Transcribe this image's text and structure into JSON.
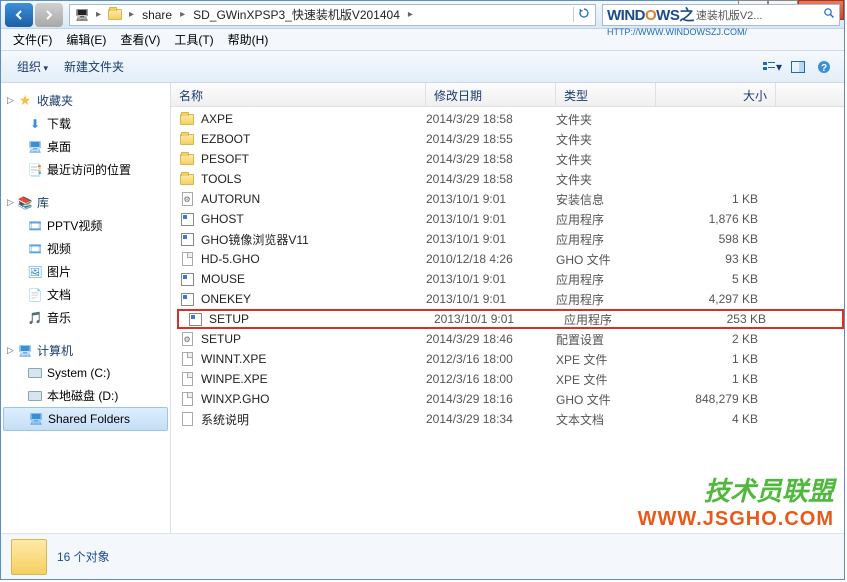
{
  "titlebar": {
    "breadcrumb": {
      "segments": [
        "share",
        "SD_GWinXPSP3_快速装机版V201404"
      ],
      "refresh": "↻"
    },
    "search": {
      "logo_prefix": "WIND",
      "logo_o": "O",
      "logo_suffix": "WS之",
      "placeholder_suffix": "速装机版V2...",
      "url": "HTTP://WWW.WINDOWSZJ.COM/"
    }
  },
  "menubar": {
    "items": [
      "文件(F)",
      "编辑(E)",
      "查看(V)",
      "工具(T)",
      "帮助(H)"
    ]
  },
  "toolbar": {
    "organize": "组织",
    "newfolder": "新建文件夹"
  },
  "sidebar": {
    "groups": [
      {
        "label": "收藏夹",
        "icon": "star",
        "items": [
          {
            "label": "下载",
            "icon": "download"
          },
          {
            "label": "桌面",
            "icon": "desktop"
          },
          {
            "label": "最近访问的位置",
            "icon": "recent"
          }
        ]
      },
      {
        "label": "库",
        "icon": "library",
        "items": [
          {
            "label": "PPTV视频",
            "icon": "video"
          },
          {
            "label": "视频",
            "icon": "video"
          },
          {
            "label": "图片",
            "icon": "picture"
          },
          {
            "label": "文档",
            "icon": "document"
          },
          {
            "label": "音乐",
            "icon": "music"
          }
        ]
      },
      {
        "label": "计算机",
        "icon": "computer",
        "items": [
          {
            "label": "System (C:)",
            "icon": "drive"
          },
          {
            "label": "本地磁盘 (D:)",
            "icon": "drive"
          },
          {
            "label": "Shared Folders",
            "icon": "netdrive",
            "selected": true
          }
        ]
      }
    ]
  },
  "columns": {
    "name": "名称",
    "date": "修改日期",
    "type": "类型",
    "size": "大小"
  },
  "files": [
    {
      "name": "AXPE",
      "date": "2014/3/29 18:58",
      "type": "文件夹",
      "size": "",
      "icon": "folder"
    },
    {
      "name": "EZBOOT",
      "date": "2014/3/29 18:55",
      "type": "文件夹",
      "size": "",
      "icon": "folder"
    },
    {
      "name": "PESOFT",
      "date": "2014/3/29 18:58",
      "type": "文件夹",
      "size": "",
      "icon": "folder"
    },
    {
      "name": "TOOLS",
      "date": "2014/3/29 18:58",
      "type": "文件夹",
      "size": "",
      "icon": "folder"
    },
    {
      "name": "AUTORUN",
      "date": "2013/10/1 9:01",
      "type": "安装信息",
      "size": "1 KB",
      "icon": "cfg"
    },
    {
      "name": "GHOST",
      "date": "2013/10/1 9:01",
      "type": "应用程序",
      "size": "1,876 KB",
      "icon": "app"
    },
    {
      "name": "GHO镜像浏览器V11",
      "date": "2013/10/1 9:01",
      "type": "应用程序",
      "size": "598 KB",
      "icon": "app"
    },
    {
      "name": "HD-5.GHO",
      "date": "2010/12/18 4:26",
      "type": "GHO 文件",
      "size": "93 KB",
      "icon": "file"
    },
    {
      "name": "MOUSE",
      "date": "2013/10/1 9:01",
      "type": "应用程序",
      "size": "5 KB",
      "icon": "app"
    },
    {
      "name": "ONEKEY",
      "date": "2013/10/1 9:01",
      "type": "应用程序",
      "size": "4,297 KB",
      "icon": "app"
    },
    {
      "name": "SETUP",
      "date": "2013/10/1 9:01",
      "type": "应用程序",
      "size": "253 KB",
      "icon": "app",
      "highlighted": true
    },
    {
      "name": "SETUP",
      "date": "2014/3/29 18:46",
      "type": "配置设置",
      "size": "2 KB",
      "icon": "cfg"
    },
    {
      "name": "WINNT.XPE",
      "date": "2012/3/16 18:00",
      "type": "XPE 文件",
      "size": "1 KB",
      "icon": "file"
    },
    {
      "name": "WINPE.XPE",
      "date": "2012/3/16 18:00",
      "type": "XPE 文件",
      "size": "1 KB",
      "icon": "file"
    },
    {
      "name": "WINXP.GHO",
      "date": "2014/3/29 18:16",
      "type": "GHO 文件",
      "size": "848,279 KB",
      "icon": "file"
    },
    {
      "name": "系统说明",
      "date": "2014/3/29 18:34",
      "type": "文本文档",
      "size": "4 KB",
      "icon": "txt"
    }
  ],
  "statusbar": {
    "count": "16 个对象"
  },
  "watermark": {
    "line1": "技术员联盟",
    "line2": "WWW.JSGHO.COM"
  }
}
